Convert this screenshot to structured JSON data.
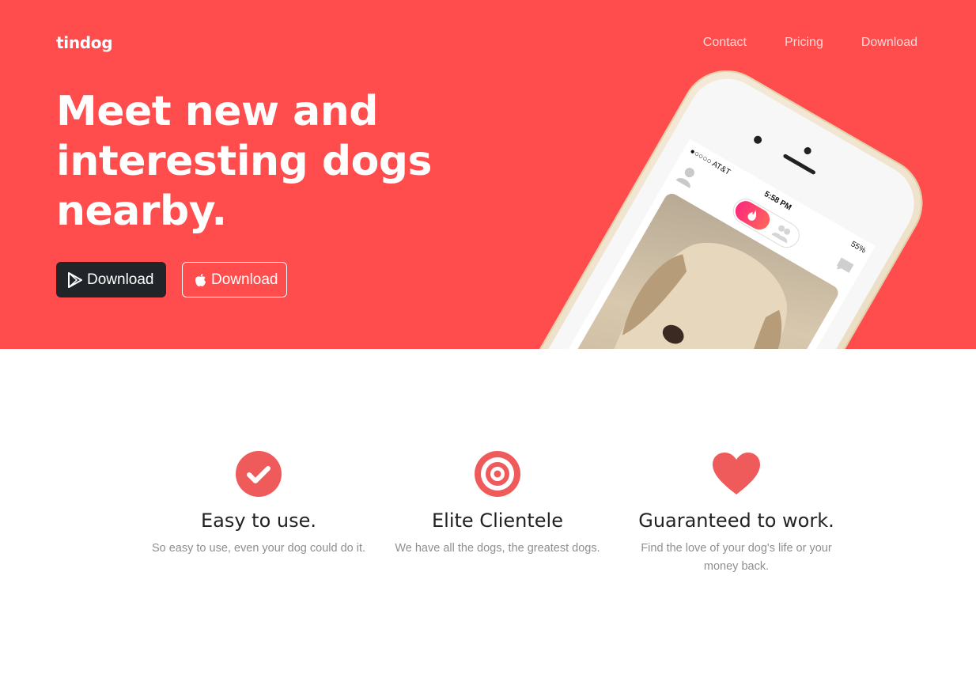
{
  "brand": {
    "name": "tindog"
  },
  "nav": {
    "items": [
      "Contact",
      "Pricing",
      "Download"
    ]
  },
  "hero": {
    "headline": "Meet new and interesting dogs nearby.",
    "buttons": {
      "google_play_label": "Download",
      "app_store_label": "Download"
    }
  },
  "phone": {
    "carrier": "●○○○○ AT&T",
    "time": "5:58 PM",
    "battery": "55%"
  },
  "features": [
    {
      "icon": "check-circle-icon",
      "title": "Easy to use.",
      "description": "So easy to use, even your dog could do it."
    },
    {
      "icon": "bullseye-icon",
      "title": "Elite Clientele",
      "description": "We have all the dogs, the greatest dogs."
    },
    {
      "icon": "heart-icon",
      "title": "Guaranteed to work.",
      "description": "Find the love of your dog's life or your money back."
    }
  ],
  "colors": {
    "brand_red": "#ff4c4c",
    "dark_button": "#212529",
    "icon_red": "#ef5b5b",
    "text_dark": "#222222",
    "text_muted": "#8f8f8f"
  }
}
